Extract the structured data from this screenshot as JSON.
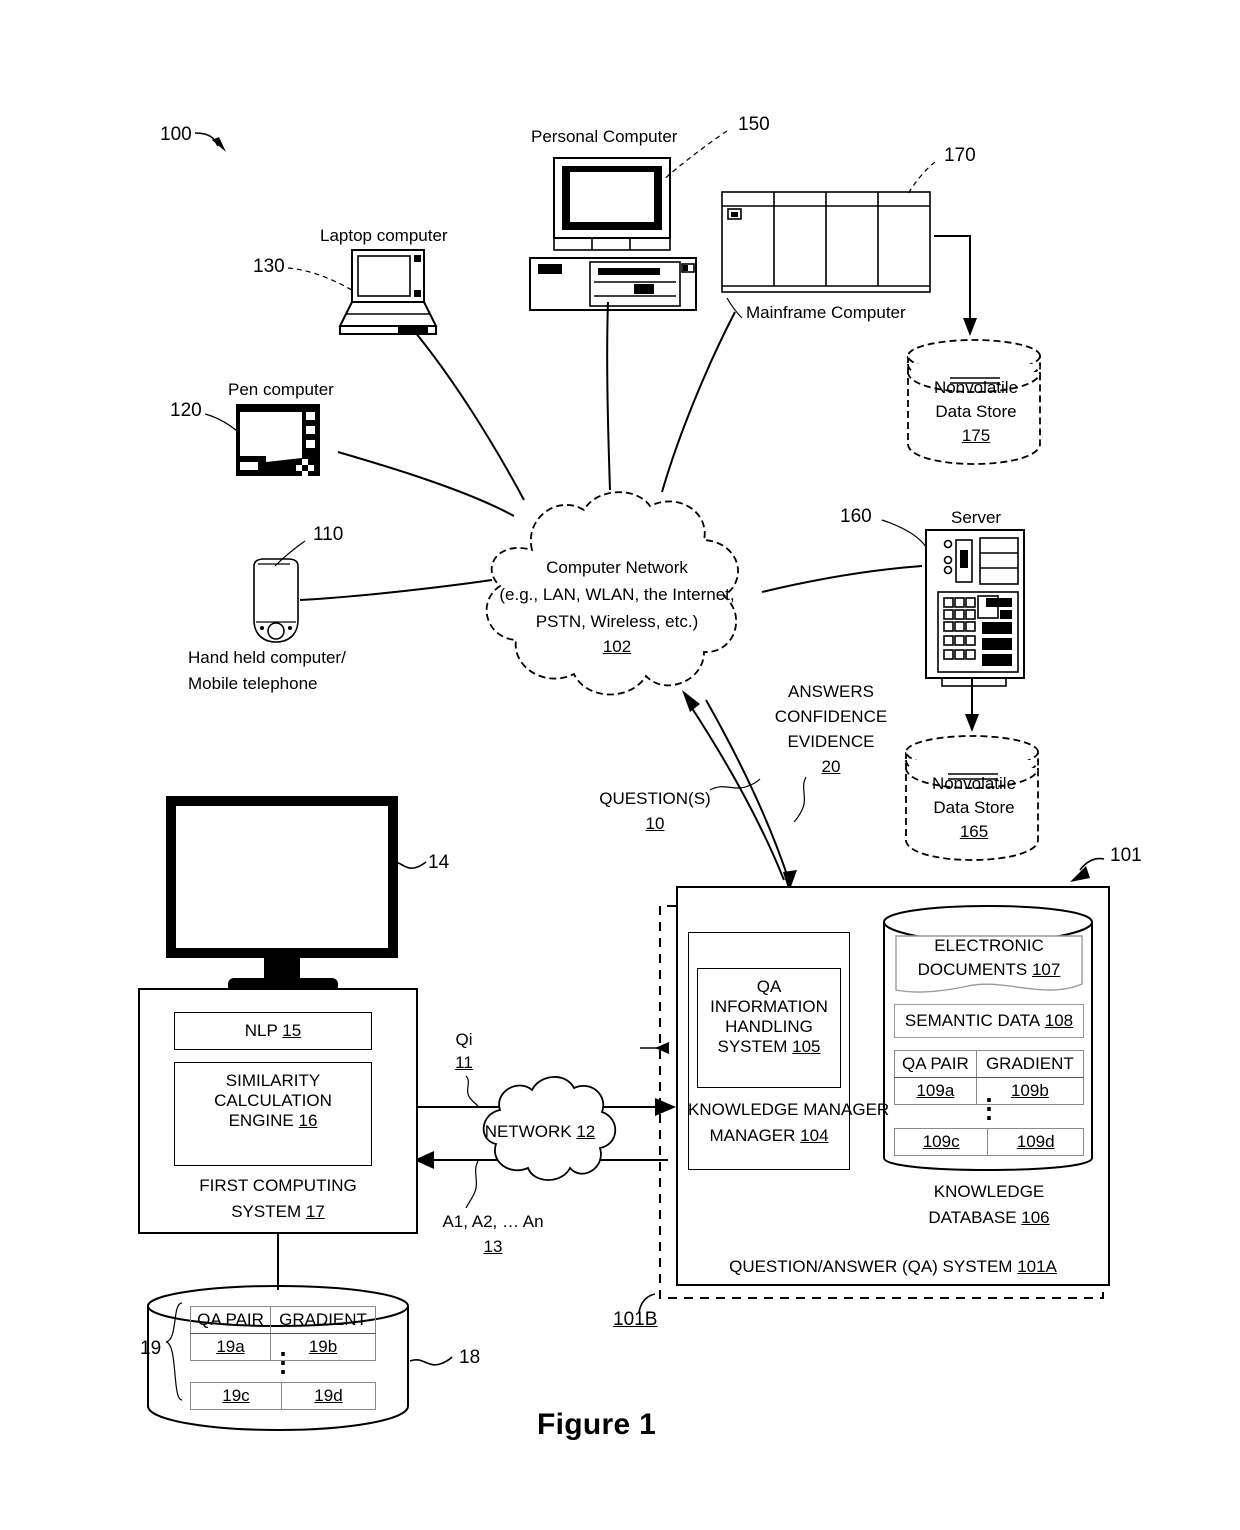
{
  "figure": {
    "caption": "Figure 1",
    "system_ref": "100"
  },
  "network_cloud": {
    "line1": "Computer Network",
    "line2": "(e.g., LAN, WLAN, the Internet,",
    "line3": "PSTN, Wireless, etc.)",
    "ref": "102"
  },
  "devices": [
    {
      "name": "laptop-computer",
      "label": "Laptop computer",
      "ref": "130"
    },
    {
      "name": "pen-computer",
      "label": "Pen computer",
      "ref": "120"
    },
    {
      "name": "handheld-computer",
      "label_line1": "Hand held computer/",
      "label_line2": "Mobile telephone",
      "ref": "110"
    },
    {
      "name": "personal-computer",
      "label": "Personal Computer",
      "ref": "150"
    },
    {
      "name": "mainframe-computer",
      "label": "Mainframe Computer",
      "ref": "170"
    },
    {
      "name": "server",
      "label": "Server",
      "ref": "160"
    }
  ],
  "data_stores": [
    {
      "name": "nonvolatile-data-store-175",
      "line1": "Nonvolatile",
      "line2": "Data Store",
      "ref": "175"
    },
    {
      "name": "nonvolatile-data-store-165",
      "line1": "Nonvolatile",
      "line2": "Data Store",
      "ref": "165"
    }
  ],
  "flows": {
    "questions_label": "QUESTION(S)",
    "questions_ref": "10",
    "answers_line1": "ANSWERS",
    "answers_line2": "CONFIDENCE",
    "answers_line3": "EVIDENCE",
    "answers_ref": "20"
  },
  "qa_system": {
    "outer_ref": "101",
    "dashed_ref": "101B",
    "title": "QUESTION/ANSWER (QA) SYSTEM",
    "title_ref": "101A",
    "knowledge_manager": {
      "label": "KNOWLEDGE MANAGER",
      "ref": "104",
      "inner": {
        "line1": "QA",
        "line2": "INFORMATION",
        "line3": "HANDLING",
        "line4": "SYSTEM",
        "ref": "105"
      }
    },
    "knowledge_database": {
      "label_line1": "KNOWLEDGE",
      "label_line2": "DATABASE",
      "ref": "106",
      "electronic_documents": {
        "line1": "ELECTRONIC",
        "line2": "DOCUMENTS",
        "ref": "107"
      },
      "semantic_data": {
        "label": "SEMANTIC DATA",
        "ref": "108"
      },
      "table": {
        "headers": [
          "QA PAIR",
          "GRADIENT"
        ],
        "row_top": [
          "109a",
          "109b"
        ],
        "row_bottom": [
          "109c",
          "109d"
        ],
        "ellipsis": "⋮"
      }
    }
  },
  "first_system": {
    "monitor_ref": "14",
    "nlp": {
      "label": "NLP",
      "ref": "15"
    },
    "similarity_engine": {
      "line1": "SIMILARITY",
      "line2": "CALCULATION",
      "line3": "ENGINE",
      "ref": "16"
    },
    "title_line1": "FIRST COMPUTING",
    "title_line2": "SYSTEM",
    "title_ref": "17",
    "database": {
      "ref": "18",
      "group_ref": "19",
      "headers": [
        "QA PAIR",
        "GRADIENT"
      ],
      "row_top": [
        "19a",
        "19b"
      ],
      "row_bottom": [
        "19c",
        "19d"
      ],
      "ellipsis": "⋮"
    }
  },
  "middle_network": {
    "label": "NETWORK",
    "ref": "12",
    "qi_label": "Qi",
    "qi_ref": "11",
    "answers_label": "A1, A2, … An",
    "answers_ref": "13"
  }
}
